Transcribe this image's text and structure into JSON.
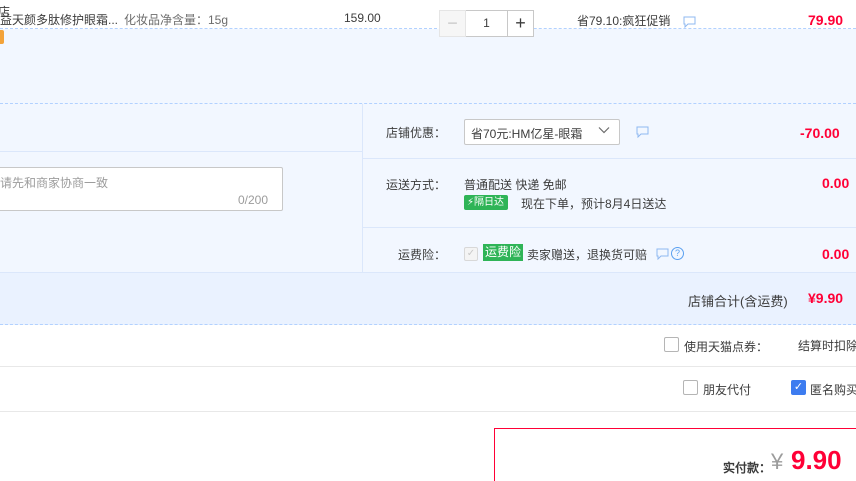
{
  "shop": {
    "name": "店"
  },
  "item": {
    "title": "益天颜多肽修护眼霜...",
    "spec": "化妆品净含量：15g",
    "unit_price": "159.00",
    "quantity": "1",
    "minus_label": "−",
    "plus_label": "+",
    "promo": "省79.10:疯狂促销",
    "total": "79.90"
  },
  "memo": {
    "placeholder": "请先和商家协商一致",
    "count": "0/200"
  },
  "coupon": {
    "label": "店铺优惠：",
    "selected": "省70元:HM亿星-眼霜",
    "amount": "-70.00"
  },
  "shipping": {
    "label": "运送方式：",
    "method": "普通配送 快递 免邮",
    "badge": "隔日达",
    "eta": "现在下单，预计8月4日送达",
    "amount": "0.00"
  },
  "insurance": {
    "label": "运费险：",
    "badge": "运费险",
    "desc": "卖家赠送，退换货可赔",
    "help": "?",
    "amount": "0.00"
  },
  "shop_total": {
    "label": "店铺合计(含运费)",
    "value": "¥9.90"
  },
  "points": {
    "label": "使用天猫点券：",
    "note": "结算时扣除"
  },
  "options": {
    "friend_pay": "朋友代付",
    "anonymous": "匿名购买"
  },
  "payment": {
    "label": "实付款：",
    "currency": "¥",
    "amount": "9.90"
  },
  "colors": {
    "accent": "#ff0036",
    "rowbg": "#f2f7ff",
    "green": "#2fb457",
    "blue": "#3d7cf0"
  }
}
